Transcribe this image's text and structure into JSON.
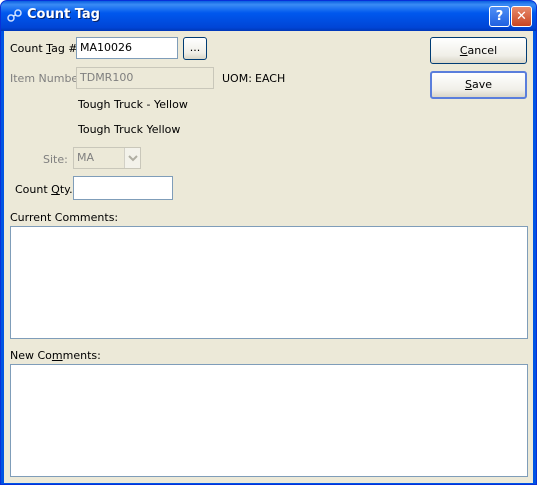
{
  "window": {
    "title": "Count Tag",
    "help_glyph": "?",
    "close_glyph": "✕"
  },
  "form": {
    "count_tag_label_pre": "Count ",
    "count_tag_label_ul": "T",
    "count_tag_label_post": "ag #:",
    "count_tag_value": "MA10026",
    "lookup_label": "...",
    "item_number_label": "Item Number:",
    "item_number_value": "TDMR100",
    "uom_label": "UOM:",
    "uom_value": "EACH",
    "desc1": "Tough Truck - Yellow",
    "desc2": "Tough Truck Yellow",
    "site_label": "Site:",
    "site_value": "MA",
    "count_qty_label_pre": "Count ",
    "count_qty_label_ul": "Q",
    "count_qty_label_post": "ty.:",
    "count_qty_value": "",
    "current_comments_label": "Current Comments:",
    "new_comments_label_pre": "New Co",
    "new_comments_label_ul": "m",
    "new_comments_label_post": "ments:"
  },
  "buttons": {
    "cancel_ul": "C",
    "cancel_rest": "ancel",
    "save_ul": "S",
    "save_rest": "ave"
  }
}
